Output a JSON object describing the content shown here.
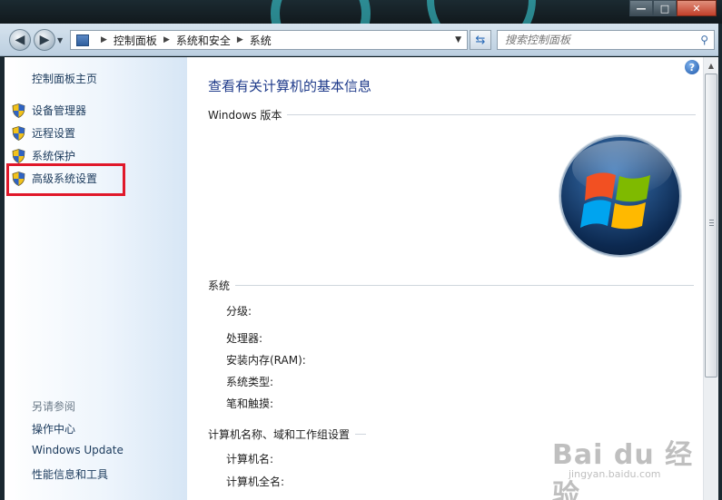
{
  "window": {
    "minimize_glyph": "—",
    "maximize_glyph": "□",
    "close_glyph": "✕"
  },
  "navbar": {
    "back_icon": "arrow-left-icon",
    "forward_icon": "arrow-right-icon",
    "breadcrumb": [
      "控制面板",
      "系统和安全",
      "系统"
    ],
    "search_placeholder": "搜索控制面板"
  },
  "sidebar": {
    "home": "控制面板主页",
    "tasks": [
      {
        "label": "设备管理器"
      },
      {
        "label": "远程设置"
      },
      {
        "label": "系统保护"
      },
      {
        "label": "高级系统设置"
      }
    ],
    "see_also_title": "另请参阅",
    "see_also": [
      {
        "label": "操作中心"
      },
      {
        "label": "Windows Update"
      },
      {
        "label": "性能信息和工具"
      }
    ]
  },
  "main": {
    "title": "查看有关计算机的基本信息",
    "windows_edition_heading": "Windows 版本",
    "system_heading": "系统",
    "system_fields": [
      "分级:",
      "处理器:",
      "安装内存(RAM):",
      "系统类型:",
      "笔和触摸:"
    ],
    "computer_heading": "计算机名称、域和工作组设置",
    "computer_fields": [
      "计算机名:",
      "计算机全名:"
    ],
    "help_glyph": "?"
  },
  "watermark": {
    "brand": "Bai du 经验",
    "url": "jingyan.baidu.com"
  },
  "colors": {
    "link": "#1b3a5c",
    "title": "#1e3a8a",
    "highlight": "#e0182a"
  }
}
